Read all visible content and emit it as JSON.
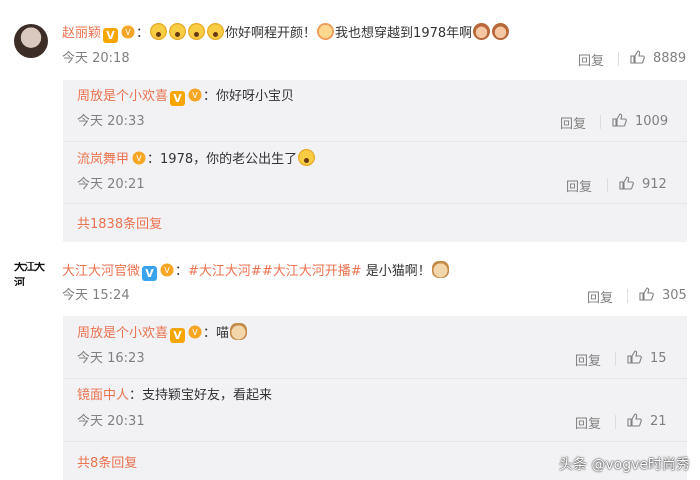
{
  "comment1": {
    "author": "赵丽颖",
    "colon": "：",
    "text_a": "你好啊程开颜！",
    "text_b": "我也想穿越到1978年啊",
    "time": "今天 20:18",
    "reply_label": "回复",
    "likes": "8889",
    "replies": [
      {
        "author": "周放是个小欢喜",
        "colon": "：",
        "text": "你好呀小宝贝",
        "time": "今天 20:33",
        "reply_label": "回复",
        "likes": "1009"
      },
      {
        "author": "流岚舞甲",
        "colon": "：",
        "text": "1978，你的老公出生了",
        "time": "今天 20:21",
        "reply_label": "回复",
        "likes": "912"
      }
    ],
    "more_replies": "共1838条回复"
  },
  "comment2": {
    "author": "大江大河官微",
    "avatar_text": "大江大河",
    "colon": "：",
    "tag1": "#大江大河#",
    "tag2": "#大江大河开播#",
    "text": " 是小猫啊！",
    "time": "今天 15:24",
    "reply_label": "回复",
    "likes": "305",
    "replies": [
      {
        "author": "周放是个小欢喜",
        "colon": "：",
        "text": "喵",
        "time": "今天 16:23",
        "reply_label": "回复",
        "likes": "15"
      },
      {
        "author": "镜面中人",
        "colon": "：",
        "text": "支持颖宝好友，看起来",
        "time": "今天 20:31",
        "reply_label": "回复",
        "likes": "21"
      }
    ],
    "more_replies": "共8条回复"
  },
  "watermark": "头条 @vogve时尚秀",
  "colors": {
    "name": "#eb7350",
    "meta": "#808080",
    "box_bg": "#f2f2f5"
  }
}
